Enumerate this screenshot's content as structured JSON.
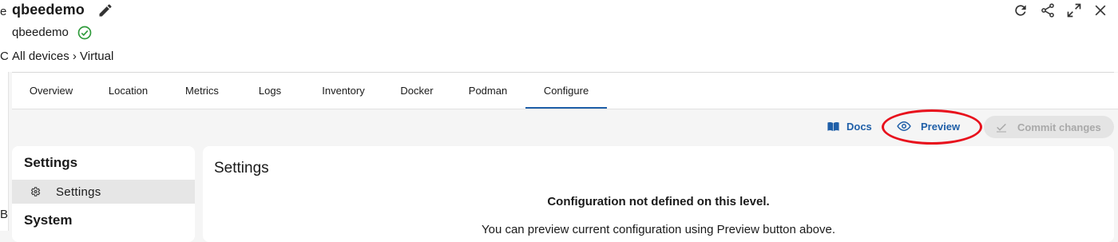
{
  "header": {
    "title": "qbeedemo",
    "subtitle": "qbeedemo",
    "breadcrumb": "All devices › Virtual",
    "icons": [
      "edit-icon",
      "check-circle-icon",
      "refresh-icon",
      "share-icon",
      "expand-icon",
      "close-icon"
    ]
  },
  "left_strip": {
    "chars": [
      "e",
      "C",
      "B"
    ]
  },
  "tabs": [
    {
      "label": "Overview"
    },
    {
      "label": "Location"
    },
    {
      "label": "Metrics"
    },
    {
      "label": "Logs"
    },
    {
      "label": "Inventory"
    },
    {
      "label": "Docker"
    },
    {
      "label": "Podman"
    },
    {
      "label": "Configure",
      "active": true
    }
  ],
  "actions": {
    "docs_label": "Docs",
    "preview_label": "Preview",
    "commit_label": "Commit changes"
  },
  "sidebar": {
    "heading": "Settings",
    "item_label": "Settings",
    "section2": "System"
  },
  "main": {
    "title": "Settings",
    "notice_title": "Configuration not defined on this level.",
    "notice_text": "You can preview current configuration using Preview button above."
  },
  "colors": {
    "accent": "#1f5fa8",
    "highlight": "#e8101c",
    "success": "#2e9a3a",
    "disabled": "#a9a9a9"
  }
}
